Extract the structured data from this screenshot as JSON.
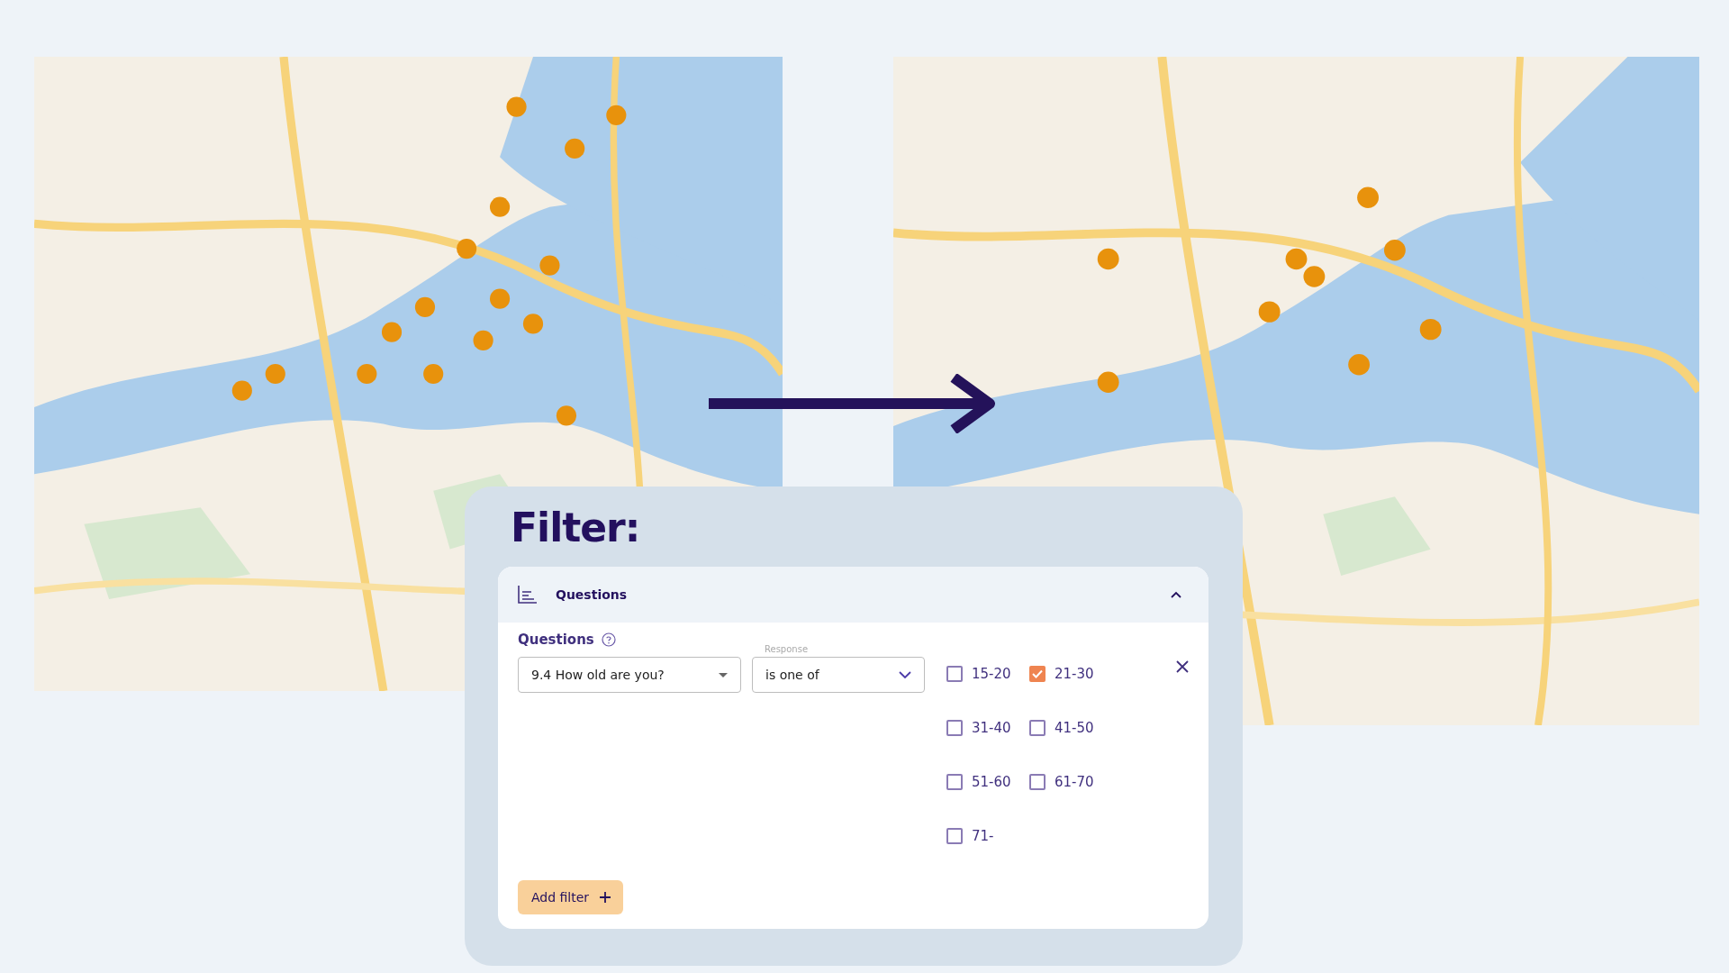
{
  "filter": {
    "title": "Filter:",
    "section": {
      "title": "Questions",
      "expanded": true
    },
    "field_label": "Questions",
    "question": {
      "value": "9.4 How old are you?"
    },
    "response": {
      "label": "Response",
      "value": "is one of"
    },
    "options": [
      {
        "label": "15-20",
        "checked": false
      },
      {
        "label": "21-30",
        "checked": true
      },
      {
        "label": "31-40",
        "checked": false
      },
      {
        "label": "41-50",
        "checked": false
      },
      {
        "label": "51-60",
        "checked": false
      },
      {
        "label": "61-70",
        "checked": false
      },
      {
        "label": "71-",
        "checked": false
      }
    ],
    "add_button": "Add filter"
  }
}
